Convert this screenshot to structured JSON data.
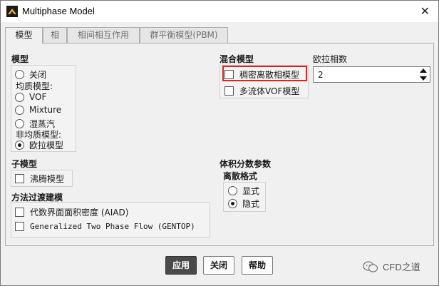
{
  "window": {
    "title": "Multiphase Model"
  },
  "tabs": [
    {
      "label": "模型",
      "active": true
    },
    {
      "label": "相",
      "active": false
    },
    {
      "label": "相间相互作用",
      "active": false
    },
    {
      "label": "群平衡模型(PBM)",
      "active": false
    }
  ],
  "model": {
    "title": "模型",
    "off": "关闭",
    "homogeneous_label": "均质模型:",
    "vof": "VOF",
    "mixture": "Mixture",
    "wet_steam": "湿蒸汽",
    "inhomogeneous_label": "非均质模型:",
    "euler": "欧拉模型",
    "selected": "euler"
  },
  "mixture_model": {
    "title": "混合模型",
    "dense_discrete": "稠密离散相模型",
    "multifluid_vof": "多流体VOF模型"
  },
  "euler_phases": {
    "label": "欧拉相数",
    "value": "2"
  },
  "sub_model": {
    "title": "子模型",
    "boiling": "沸腾模型"
  },
  "transition": {
    "title": "方法过渡建模",
    "aiad": "代数界面面积密度 (AIAD)",
    "gentop": "Generalized Two Phase Flow (GENTOP)"
  },
  "volume_fraction": {
    "title": "体积分数参数",
    "scheme_label": "离散格式",
    "explicit": "显式",
    "implicit": "隐式",
    "selected": "implicit"
  },
  "buttons": {
    "apply": "应用",
    "close": "关闭",
    "help": "帮助"
  },
  "watermark": {
    "text": "CFD之道"
  },
  "colors": {
    "highlight": "#e0241b",
    "primary_button": "#4a4a4a"
  }
}
